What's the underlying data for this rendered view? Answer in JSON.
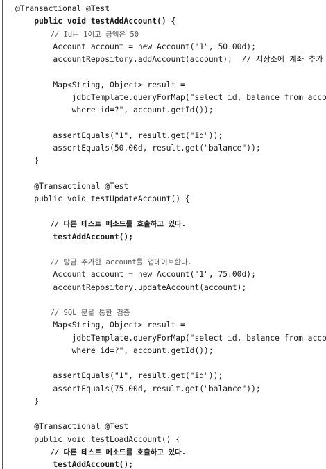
{
  "code": {
    "lines": [
      {
        "text": "@Transactional @Test",
        "bold": false,
        "comment": false
      },
      {
        "text": "    public void testAddAccount() {",
        "bold": true,
        "comment": false
      },
      {
        "text": "        // Id는 1이고 금액은 50",
        "bold": false,
        "comment": true
      },
      {
        "text": "        Account account = new Account(\"1\", 50.00d);",
        "bold": false,
        "comment": false
      },
      {
        "text": "        accountRepository.addAccount(account);  // 저장소에 계좌 추가",
        "bold": false,
        "comment": false
      },
      {
        "text": "",
        "bold": false,
        "comment": false
      },
      {
        "text": "        Map<String, Object> result =",
        "bold": false,
        "comment": false
      },
      {
        "text": "            jdbcTemplate.queryForMap(\"select id, balance from account",
        "bold": false,
        "comment": false
      },
      {
        "text": "            where id=?\", account.getId());",
        "bold": false,
        "comment": false
      },
      {
        "text": "",
        "bold": false,
        "comment": false
      },
      {
        "text": "        assertEquals(\"1\", result.get(\"id\"));",
        "bold": false,
        "comment": false
      },
      {
        "text": "        assertEquals(50.00d, result.get(\"balance\"));",
        "bold": false,
        "comment": false
      },
      {
        "text": "    }",
        "bold": false,
        "comment": false
      },
      {
        "text": "",
        "bold": false,
        "comment": false
      },
      {
        "text": "    @Transactional @Test",
        "bold": false,
        "comment": false
      },
      {
        "text": "    public void testUpdateAccount() {",
        "bold": false,
        "comment": false
      },
      {
        "text": "",
        "bold": false,
        "comment": false
      },
      {
        "text": "        // 다른 테스트 메소드를 호출하고 있다.",
        "bold": true,
        "comment": true
      },
      {
        "text": "        testAddAccount();",
        "bold": true,
        "comment": false
      },
      {
        "text": "",
        "bold": false,
        "comment": false
      },
      {
        "text": "        // 방금 추가한 account를 업데이트한다.",
        "bold": false,
        "comment": true
      },
      {
        "text": "        Account account = new Account(\"1\", 75.00d);",
        "bold": false,
        "comment": false
      },
      {
        "text": "        accountRepository.updateAccount(account);",
        "bold": false,
        "comment": false
      },
      {
        "text": "",
        "bold": false,
        "comment": false
      },
      {
        "text": "        // SQL 문을 통한 검증",
        "bold": false,
        "comment": true
      },
      {
        "text": "        Map<String, Object> result =",
        "bold": false,
        "comment": false
      },
      {
        "text": "            jdbcTemplate.queryForMap(\"select id, balance from account",
        "bold": false,
        "comment": false
      },
      {
        "text": "            where id=?\", account.getId());",
        "bold": false,
        "comment": false
      },
      {
        "text": "",
        "bold": false,
        "comment": false
      },
      {
        "text": "        assertEquals(\"1\", result.get(\"id\"));",
        "bold": false,
        "comment": false
      },
      {
        "text": "        assertEquals(75.00d, result.get(\"balance\"));",
        "bold": false,
        "comment": false
      },
      {
        "text": "    }",
        "bold": false,
        "comment": false
      },
      {
        "text": "",
        "bold": false,
        "comment": false
      },
      {
        "text": "    @Transactional @Test",
        "bold": false,
        "comment": false
      },
      {
        "text": "    public void testLoadAccount() {",
        "bold": false,
        "comment": false
      },
      {
        "text": "        // 다른 테스트 메소드를 호출하고 있다.",
        "bold": true,
        "comment": true
      },
      {
        "text": "        testAddAccount();",
        "bold": true,
        "comment": false
      }
    ]
  }
}
